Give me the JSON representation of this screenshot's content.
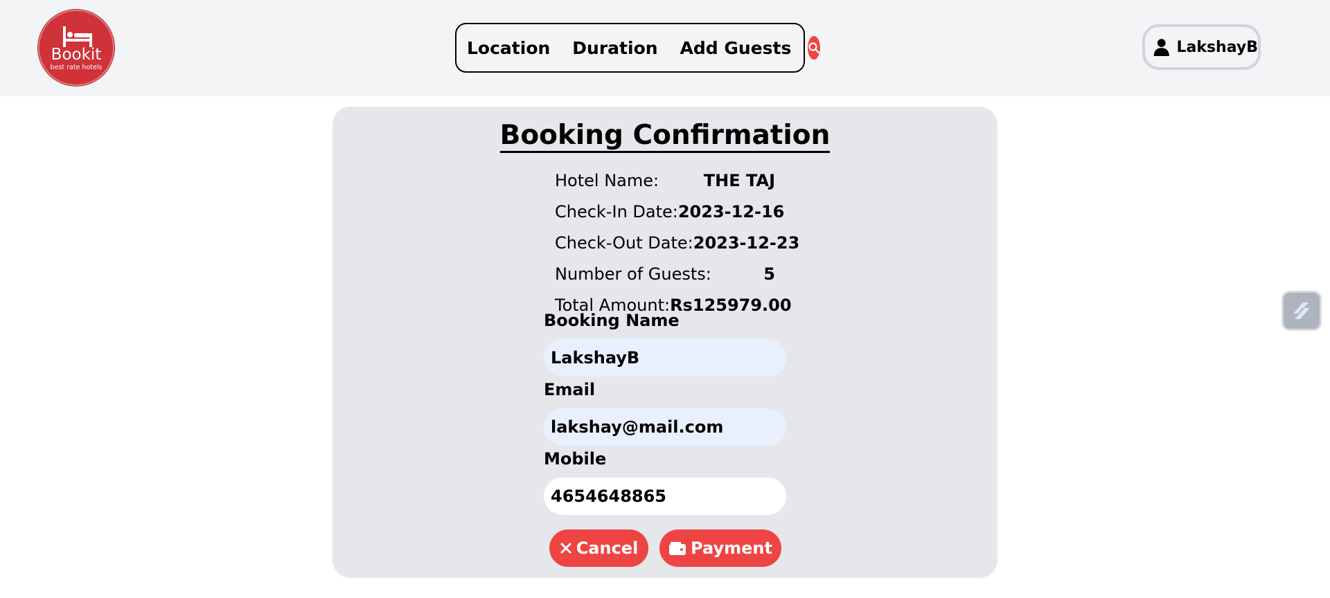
{
  "brand": {
    "name": "Bookit",
    "tagline": "best rate hotels",
    "icon": "bed-icon",
    "color": "#cf3238"
  },
  "search": {
    "segments": [
      {
        "label": "Location"
      },
      {
        "label": "Duration"
      },
      {
        "label": "Add Guests"
      }
    ],
    "button_icon": "search-icon",
    "accent": "#ef4444"
  },
  "user": {
    "name": "LakshayB",
    "icon": "user-icon"
  },
  "booking": {
    "title": "Booking Confirmation",
    "details": [
      {
        "label": "Hotel Name:",
        "value": "THE TAJ"
      },
      {
        "label": "Check-In Date:",
        "value": "2023-12-16"
      },
      {
        "label": "Check-Out Date:",
        "value": "2023-12-23"
      },
      {
        "label": "Number of Guests:",
        "value": "5"
      },
      {
        "label": "Total Amount:",
        "value": "Rs125979.00"
      }
    ],
    "form": {
      "booking_name": {
        "label": "Booking Name",
        "value": "LakshayB"
      },
      "email": {
        "label": "Email",
        "value": "lakshay@mail.com"
      },
      "mobile": {
        "label": "Mobile",
        "value": "4654648865"
      }
    },
    "actions": {
      "cancel": {
        "label": "Cancel",
        "icon": "close-icon"
      },
      "payment": {
        "label": "Payment",
        "icon": "wallet-icon"
      }
    }
  },
  "side_widget": {
    "icon": "extension-icon"
  }
}
